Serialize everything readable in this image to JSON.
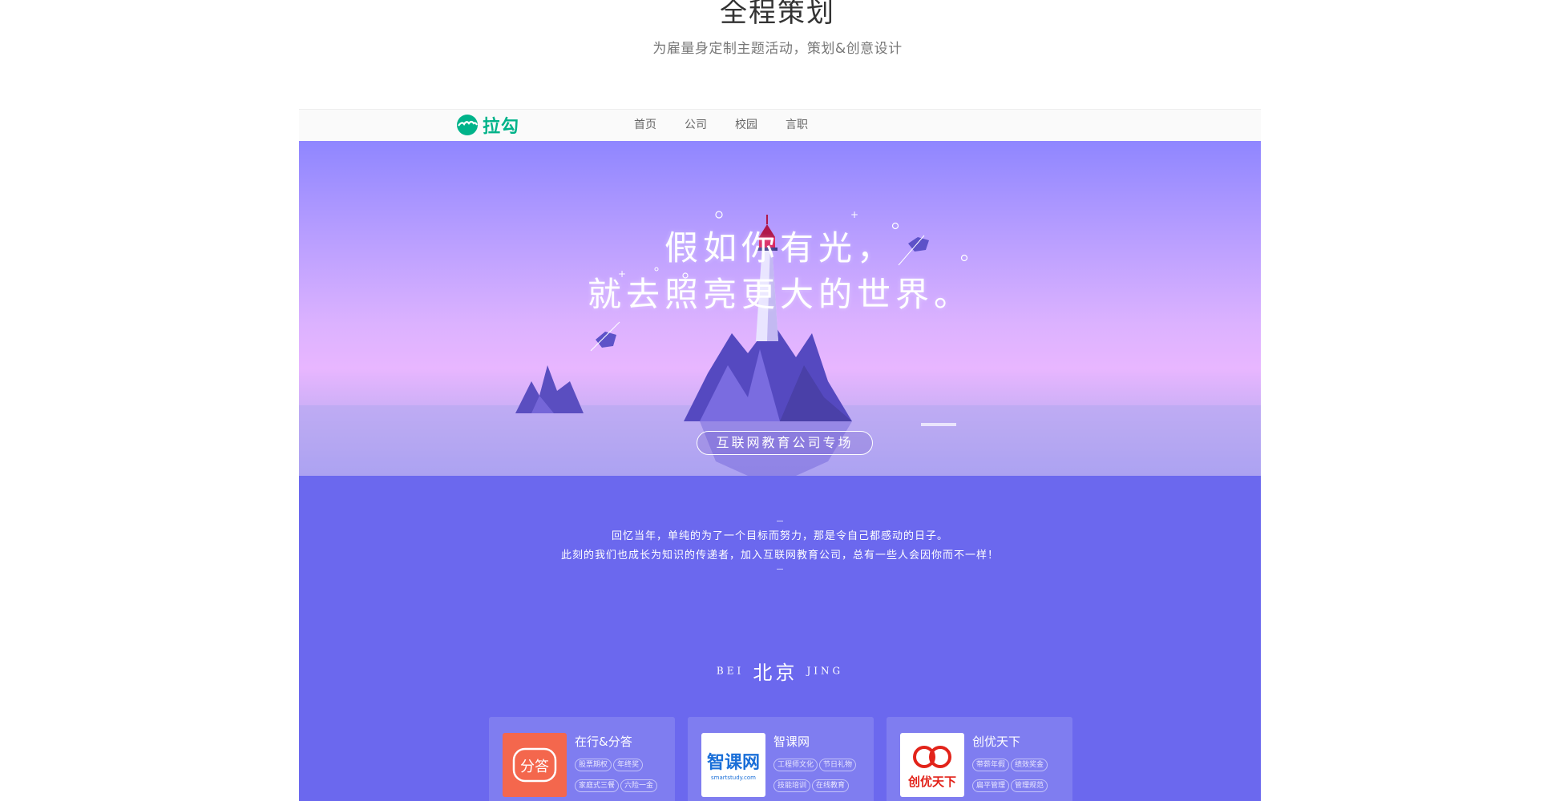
{
  "section": {
    "title": "全程策划",
    "subtitle": "为雇量身定制主题活动，策划&创意设计"
  },
  "navbar": {
    "logo_text": "拉勾",
    "items": [
      "首页",
      "公司",
      "校园",
      "言职"
    ]
  },
  "hero": {
    "line1": "假如你有光，",
    "line2": "就去照亮更大的世界。",
    "badge": "互联网教育公司专场"
  },
  "intro": {
    "line1": "回忆当年，单纯的为了一个目标而努力，那是令自己都感动的日子。",
    "line2": "此刻的我们也成长为知识的传递者，加入互联网教育公司，总有一些人会因你而不一样！"
  },
  "city": {
    "en_left": "BEI",
    "cn": "北京",
    "en_right": "JING"
  },
  "companies": [
    {
      "name": "在行&分答",
      "logo_text": "分答",
      "logo_color": "#f4674d",
      "tags": [
        "股票期权",
        "年终奖",
        "家庭式三餐",
        "六险一金"
      ]
    },
    {
      "name": "智课网",
      "logo_text": "智课网",
      "logo_sub": "smartstudy.com",
      "logo_color": "#1a6fd8",
      "tags": [
        "工程师文化",
        "节日礼物",
        "技能培训",
        "在线教育"
      ]
    },
    {
      "name": "创优天下",
      "logo_text": "创优天下",
      "logo_color": "#e2231a",
      "tags": [
        "带薪年假",
        "绩效奖金",
        "扁平管理",
        "管理规范"
      ]
    }
  ],
  "colors": {
    "brand": "#00b38a",
    "hero_top": "#8f86ff",
    "hero_pink": "#e8b6ff",
    "lower_bg": "#6b68ee"
  }
}
